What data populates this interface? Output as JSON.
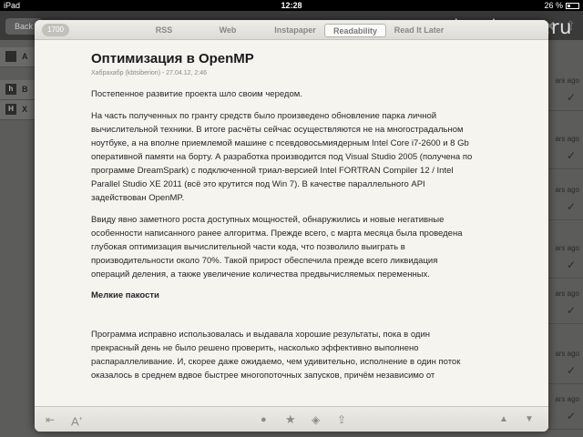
{
  "status_bar": {
    "carrier": "iPad",
    "time": "12:28",
    "battery": "26 %"
  },
  "watermark": "ipadstory.ru",
  "background_app": {
    "back_label": "Back",
    "rows": [
      {
        "icon_letter": "",
        "label": "A"
      },
      {
        "icon_letter": "h",
        "label": "B"
      },
      {
        "icon_letter": "H",
        "label": "X"
      }
    ],
    "right_label": "ars ago"
  },
  "modal": {
    "count": "1700",
    "tabs": [
      "RSS",
      "Web",
      "Instapaper",
      "Readability",
      "Read It Later"
    ],
    "active_tab": "Readability"
  },
  "article": {
    "title": "Оптимизация в OpenMP",
    "meta": "Хабрахабр (kbtsiberion) - 27.04.12, 2:46",
    "para1": "Постепенное развитие проекта шло своим чередом.",
    "para2": "На часть полученных по гранту средств было произведено обновление парка личной вычислительной техники. В итоге расчёты сейчас осуществляются не на многострадальном ноутбуке, а на вполне приемлемой машине с псевдовосьмиядерным Intel Core i7-2600 и 8 Gb оперативной памяти на борту. А разработка производится под Visual Studio 2005 (получена по программе DreamSpark) с подключенной триал-версией Intel FORTRAN Compiler 12 / Intel Parallel Studio XE 2011 (всё это крутится под Win 7). В качестве параллельного API задействован OpenMP.",
    "para3": "Ввиду явно заметного роста доступных мощностей, обнаружились и новые негативные особенности написанного ранее алгоритма. Прежде всего, с марта месяца была проведена глубокая оптимизация вычислительной части кода, что позволило выиграть в производительности около 70%. Такой прирост обеспечила прежде всего ликвидация операций деления, а также увеличение количества предвычисляемых переменных.",
    "heading": "Мелкие пакости",
    "para4": "Программа исправно использовалась и выдавала хорошие результаты, пока в один прекрасный день не было решено проверить, насколько эффективно выполнено распараллеливание. И, скорее даже ожидаемо, чем удивительно, исполнение в один поток оказалось в среднем вдвое быстрее многопоточных запусков, причём независимо от"
  },
  "toolbar": {
    "font_label": "A"
  },
  "colors": {
    "panel": "#f5f4ef",
    "toolbar": "#dedcd6",
    "icon": "#8c8c8c",
    "text": "#262626"
  },
  "icons": {
    "back": "collapse-arrow-icon",
    "font": "font-size-icon",
    "read": "mark-read-dot-icon",
    "star": "star-icon",
    "tag": "tag-icon",
    "share": "share-arrow-icon",
    "prev": "previous-article-icon",
    "next": "next-article-icon"
  }
}
